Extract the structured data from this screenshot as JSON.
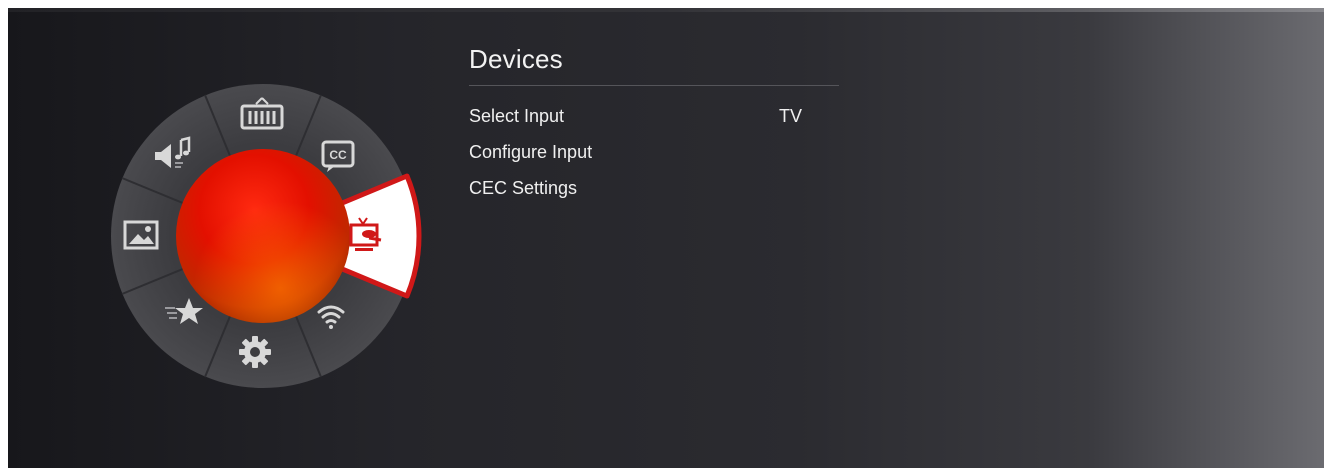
{
  "wheel": {
    "selected": "devices",
    "items": [
      {
        "id": "picture",
        "icon": "tv-picture-icon"
      },
      {
        "id": "closed-captions",
        "icon": "cc-icon"
      },
      {
        "id": "devices",
        "icon": "input-device-icon"
      },
      {
        "id": "network",
        "icon": "wifi-icon"
      },
      {
        "id": "system",
        "icon": "gear-icon"
      },
      {
        "id": "guided-setup",
        "icon": "star-icon"
      },
      {
        "id": "photos",
        "icon": "photo-icon"
      },
      {
        "id": "audio",
        "icon": "audio-icon"
      }
    ],
    "colors": {
      "ring": "#48484c",
      "ring_dark": "#3a3a3e",
      "selected_fill": "#ffffff",
      "selected_border": "#d01818",
      "orb_center": "#ff1a00",
      "orb_edge": "#9a0000",
      "icon": "#d8d8d8"
    }
  },
  "panel": {
    "title": "Devices",
    "items": [
      {
        "label": "Select Input",
        "value": "TV"
      },
      {
        "label": "Configure Input",
        "value": ""
      },
      {
        "label": "CEC Settings",
        "value": ""
      }
    ]
  }
}
